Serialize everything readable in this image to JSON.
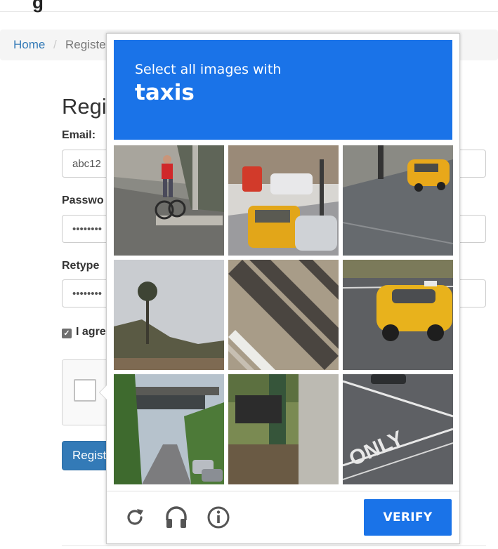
{
  "breadcrumb": {
    "home": "Home",
    "separator": "/",
    "current": "Registe"
  },
  "form": {
    "title": "Regi",
    "email_label": "Email:",
    "email_value": "abc12",
    "password_label": "Passwo",
    "password_value": "••••••••",
    "retype_label": "Retype",
    "retype_value": "••••••••",
    "agree_label": "I agre",
    "agree_checked": true,
    "register_button": "Regist"
  },
  "challenge": {
    "instruction": "Select all images with",
    "keyword": "taxis",
    "tiles": [
      {
        "scene": "cyclist on street corner"
      },
      {
        "scene": "yellow taxi in city street"
      },
      {
        "scene": "yellow taxi on road"
      },
      {
        "scene": "palm tree and sky"
      },
      {
        "scene": "shadows on pavement"
      },
      {
        "scene": "yellow taxi on road"
      },
      {
        "scene": "overpass and tree-lined road"
      },
      {
        "scene": "traffic light pole"
      },
      {
        "scene": "road with ONLY marking"
      }
    ],
    "icons": [
      "reload-icon",
      "audio-icon",
      "info-icon"
    ],
    "verify_label": "VERIFY",
    "accent": "#1a73e8"
  }
}
